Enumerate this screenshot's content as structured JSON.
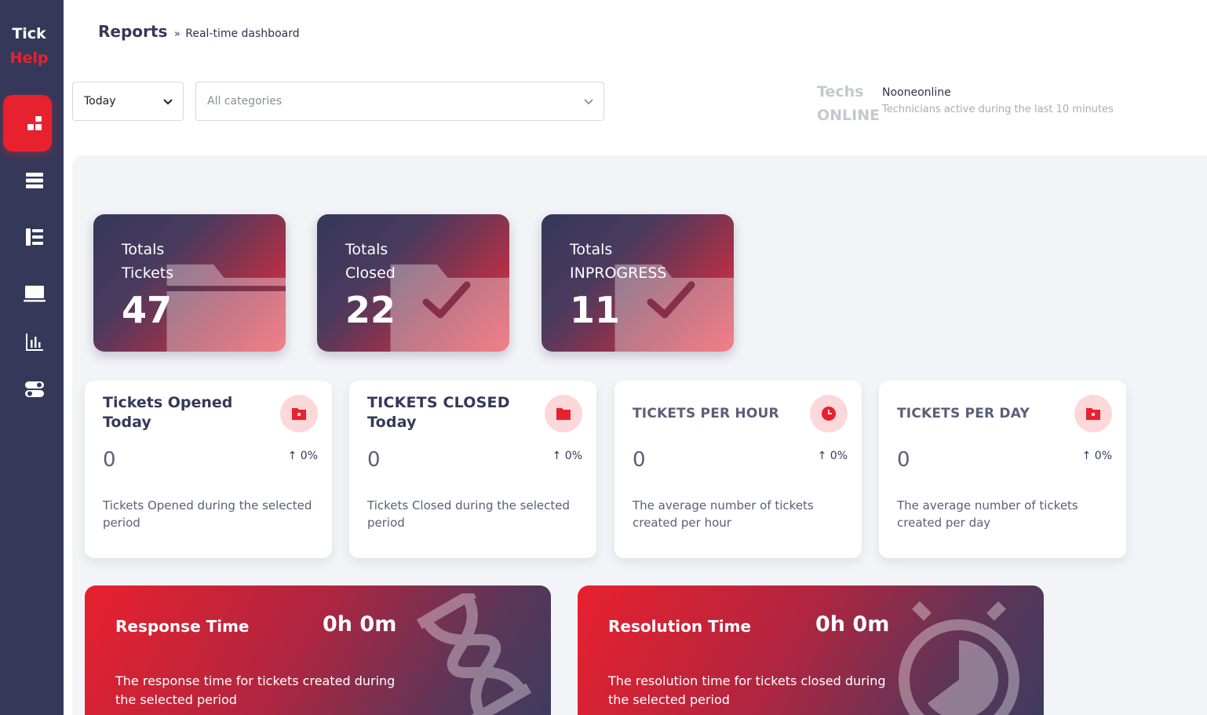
{
  "app": {
    "logo_line1": "Tick",
    "logo_line2": "Help"
  },
  "breadcrumb": {
    "main": "Reports",
    "separator": "»",
    "current": "Real-time dashboard"
  },
  "filters": {
    "period_value": "Today",
    "category_placeholder": "All categories"
  },
  "techs": {
    "title_line1": "Techs",
    "title_line2": "ONLINE",
    "status": "Nooneonline",
    "description": "Technicians active during the last 10 minutes"
  },
  "totals": [
    {
      "line1": "Totals",
      "line2": "Tickets",
      "value": "47"
    },
    {
      "line1": "Totals",
      "line2": "Closed",
      "value": "22"
    },
    {
      "line1": "Totals",
      "line2": "INPROGRESS",
      "value": "11"
    }
  ],
  "stats": [
    {
      "title": "Tickets Opened Today",
      "value": "0",
      "change": "0%",
      "description": "Tickets Opened during the selected period",
      "icon": "folder-icon"
    },
    {
      "title": "TICKETS CLOSED Today",
      "value": "0",
      "change": "0%",
      "description": "Tickets Closed during the selected period",
      "icon": "folder-closed-icon"
    },
    {
      "title": "TICKETS PER HOUR",
      "value": "0",
      "change": "0%",
      "description": "The average number of tickets created per hour",
      "icon": "clock-icon"
    },
    {
      "title": "TICKETS PER DAY",
      "value": "0",
      "change": "0%",
      "description": "The average number of tickets created per day",
      "icon": "folder-icon"
    }
  ],
  "times": [
    {
      "label": "Response Time",
      "value": "0h 0m",
      "description": "The response time for tickets created during the selected period",
      "icon": "hourglass-icon"
    },
    {
      "label": "Resolution Time",
      "value": "0h 0m",
      "description": "The resolution time for tickets closed during the selected period",
      "icon": "stopwatch-icon"
    }
  ],
  "colors": {
    "sidebar": "#363859",
    "accent": "#e8212e",
    "panel": "#f3f4f8"
  }
}
